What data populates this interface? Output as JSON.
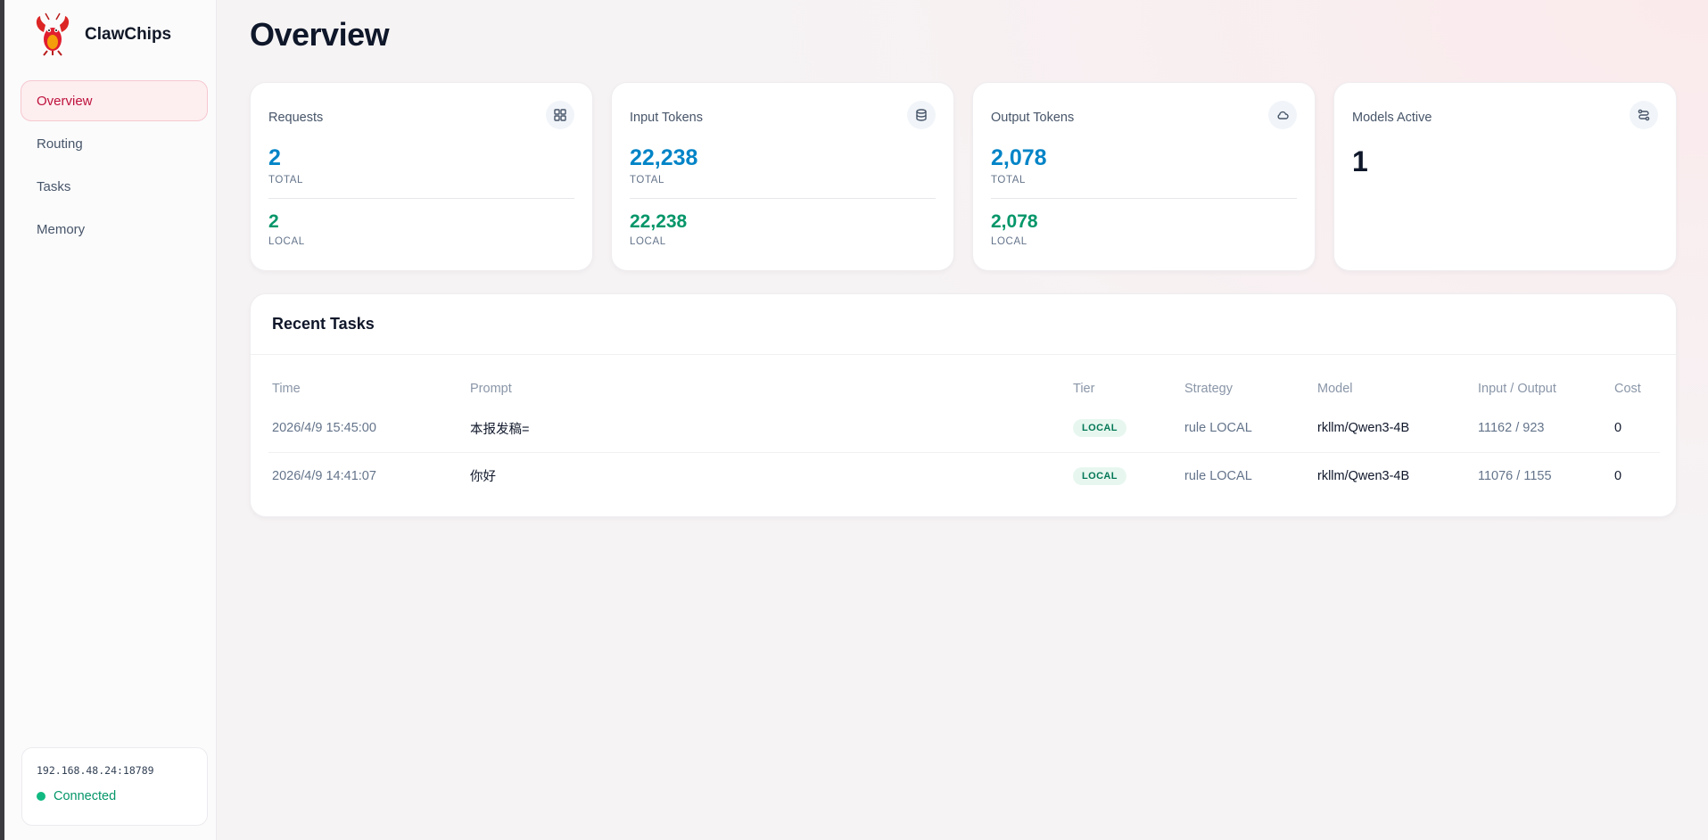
{
  "app": {
    "name": "ClawChips"
  },
  "sidebar": {
    "items": [
      {
        "label": "Overview",
        "active": true
      },
      {
        "label": "Routing"
      },
      {
        "label": "Tasks"
      },
      {
        "label": "Memory"
      }
    ],
    "connection": {
      "address": "192.168.48.24:18789",
      "status": "Connected"
    }
  },
  "page": {
    "title": "Overview"
  },
  "cards": {
    "requests": {
      "title": "Requests",
      "total": "2",
      "total_label": "TOTAL",
      "local": "2",
      "local_label": "LOCAL",
      "icon": "grid-icon"
    },
    "input_tokens": {
      "title": "Input Tokens",
      "total": "22,238",
      "total_label": "TOTAL",
      "local": "22,238",
      "local_label": "LOCAL",
      "icon": "database-icon"
    },
    "output_tokens": {
      "title": "Output Tokens",
      "total": "2,078",
      "total_label": "TOTAL",
      "local": "2,078",
      "local_label": "LOCAL",
      "icon": "cloud-icon"
    },
    "models_active": {
      "title": "Models Active",
      "value": "1",
      "icon": "route-icon"
    }
  },
  "recent_tasks": {
    "title": "Recent Tasks",
    "columns": [
      "Time",
      "Prompt",
      "Tier",
      "Strategy",
      "Model",
      "Input / Output",
      "Cost"
    ],
    "rows": [
      {
        "time": "2026/4/9 15:45:00",
        "prompt": "本报发稿=",
        "tier": "LOCAL",
        "strategy": "rule LOCAL",
        "model": "rkllm/Qwen3-4B",
        "io": "11162 / 923",
        "cost": "0"
      },
      {
        "time": "2026/4/9 14:41:07",
        "prompt": "你好",
        "tier": "LOCAL",
        "strategy": "rule LOCAL",
        "model": "rkllm/Qwen3-4B",
        "io": "11076 / 1155",
        "cost": "0"
      }
    ]
  },
  "colors": {
    "accent": "#be123c",
    "primary_value": "#0284c7",
    "local_value": "#059669",
    "connected": "#10b981"
  }
}
